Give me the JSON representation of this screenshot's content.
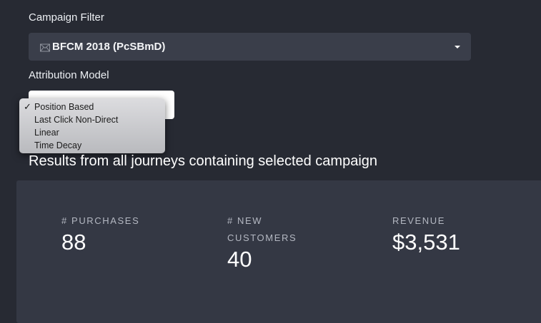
{
  "campaign_filter": {
    "label": "Campaign Filter",
    "icon": "envelope-icon",
    "selected": "BFCM 2018 (PcSBmD)"
  },
  "attribution_model": {
    "label": "Attribution Model",
    "selected": "Position Based",
    "options": [
      "Position Based",
      "Last Click Non-Direct",
      "Linear",
      "Time Decay"
    ]
  },
  "results": {
    "heading": "Results from all journeys containing selected campaign"
  },
  "stats": {
    "purchases": {
      "label": "# PURCHASES",
      "value": "88"
    },
    "new_customers": {
      "label_line1": "# NEW",
      "label_line2": "CUSTOMERS",
      "value": "40"
    },
    "revenue": {
      "label": "REVENUE",
      "value": "$3,531"
    }
  },
  "colors": {
    "background": "#272a33",
    "select_background": "#3a3e4a",
    "panel_background": "#343844",
    "stat_label": "#b4b8c2"
  }
}
